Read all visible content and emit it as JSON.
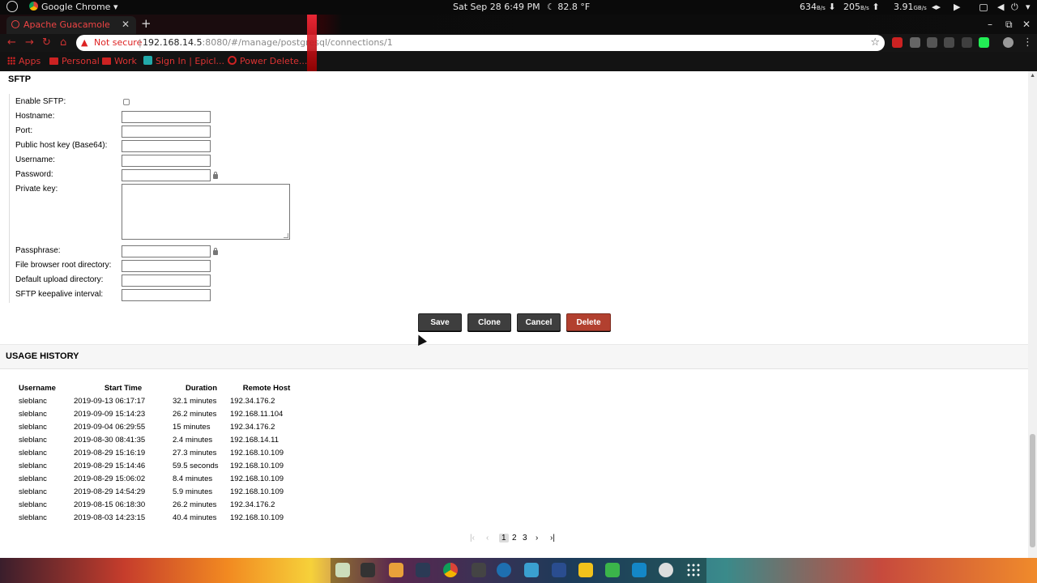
{
  "topbar": {
    "app_name": "Google Chrome",
    "datetime": "Sat Sep 28   6:49 PM",
    "weather": "82.8 °F",
    "net_down": "634",
    "net_down_unit": "B/s",
    "net_up": "205",
    "net_up_unit": "B/s",
    "load": "3.91",
    "load_unit": "GB/s"
  },
  "browser": {
    "tab_title": "Apache Guacamole",
    "security_label": "Not secure",
    "url_host": "192.168.14.5",
    "url_path": ":8080/#/manage/postgresql/connections/1",
    "bookmarks": [
      "Apps",
      "Personal",
      "Work",
      "Sign In | Epicl...",
      "Power Delete..."
    ]
  },
  "sftp": {
    "title": "SFTP",
    "fields": {
      "enable": "Enable SFTP:",
      "hostname": "Hostname:",
      "port": "Port:",
      "host_key": "Public host key (Base64):",
      "username": "Username:",
      "password": "Password:",
      "private_key": "Private key:",
      "passphrase": "Passphrase:",
      "root_dir": "File browser root directory:",
      "upload_dir": "Default upload directory:",
      "keepalive": "SFTP keepalive interval:"
    },
    "enable_checked": false
  },
  "actions": {
    "save": "Save",
    "clone": "Clone",
    "cancel": "Cancel",
    "delete": "Delete"
  },
  "history": {
    "title": "USAGE HISTORY",
    "columns": [
      "Username",
      "Start Time",
      "Duration",
      "Remote Host"
    ],
    "rows": [
      [
        "sleblanc",
        "2019-09-13 06:17:17",
        "32.1 minutes",
        "192.34.176.2"
      ],
      [
        "sleblanc",
        "2019-09-09 15:14:23",
        "26.2 minutes",
        "192.168.11.104"
      ],
      [
        "sleblanc",
        "2019-09-04 06:29:55",
        "15 minutes",
        "192.34.176.2"
      ],
      [
        "sleblanc",
        "2019-08-30 08:41:35",
        "2.4 minutes",
        "192.168.14.11"
      ],
      [
        "sleblanc",
        "2019-08-29 15:16:19",
        "27.3 minutes",
        "192.168.10.109"
      ],
      [
        "sleblanc",
        "2019-08-29 15:14:46",
        "59.5 seconds",
        "192.168.10.109"
      ],
      [
        "sleblanc",
        "2019-08-29 15:06:02",
        "8.4 minutes",
        "192.168.10.109"
      ],
      [
        "sleblanc",
        "2019-08-29 14:54:29",
        "5.9 minutes",
        "192.168.10.109"
      ],
      [
        "sleblanc",
        "2019-08-15 06:18:30",
        "26.2 minutes",
        "192.34.176.2"
      ],
      [
        "sleblanc",
        "2019-08-03 14:23:15",
        "40.4 minutes",
        "192.168.10.109"
      ]
    ],
    "pages": [
      "1",
      "2",
      "3"
    ],
    "current_page": "1"
  },
  "colors": {
    "delete_button": "#b2402f",
    "button_dark": "#3e3e3e",
    "accent_red": "#dd3333"
  }
}
